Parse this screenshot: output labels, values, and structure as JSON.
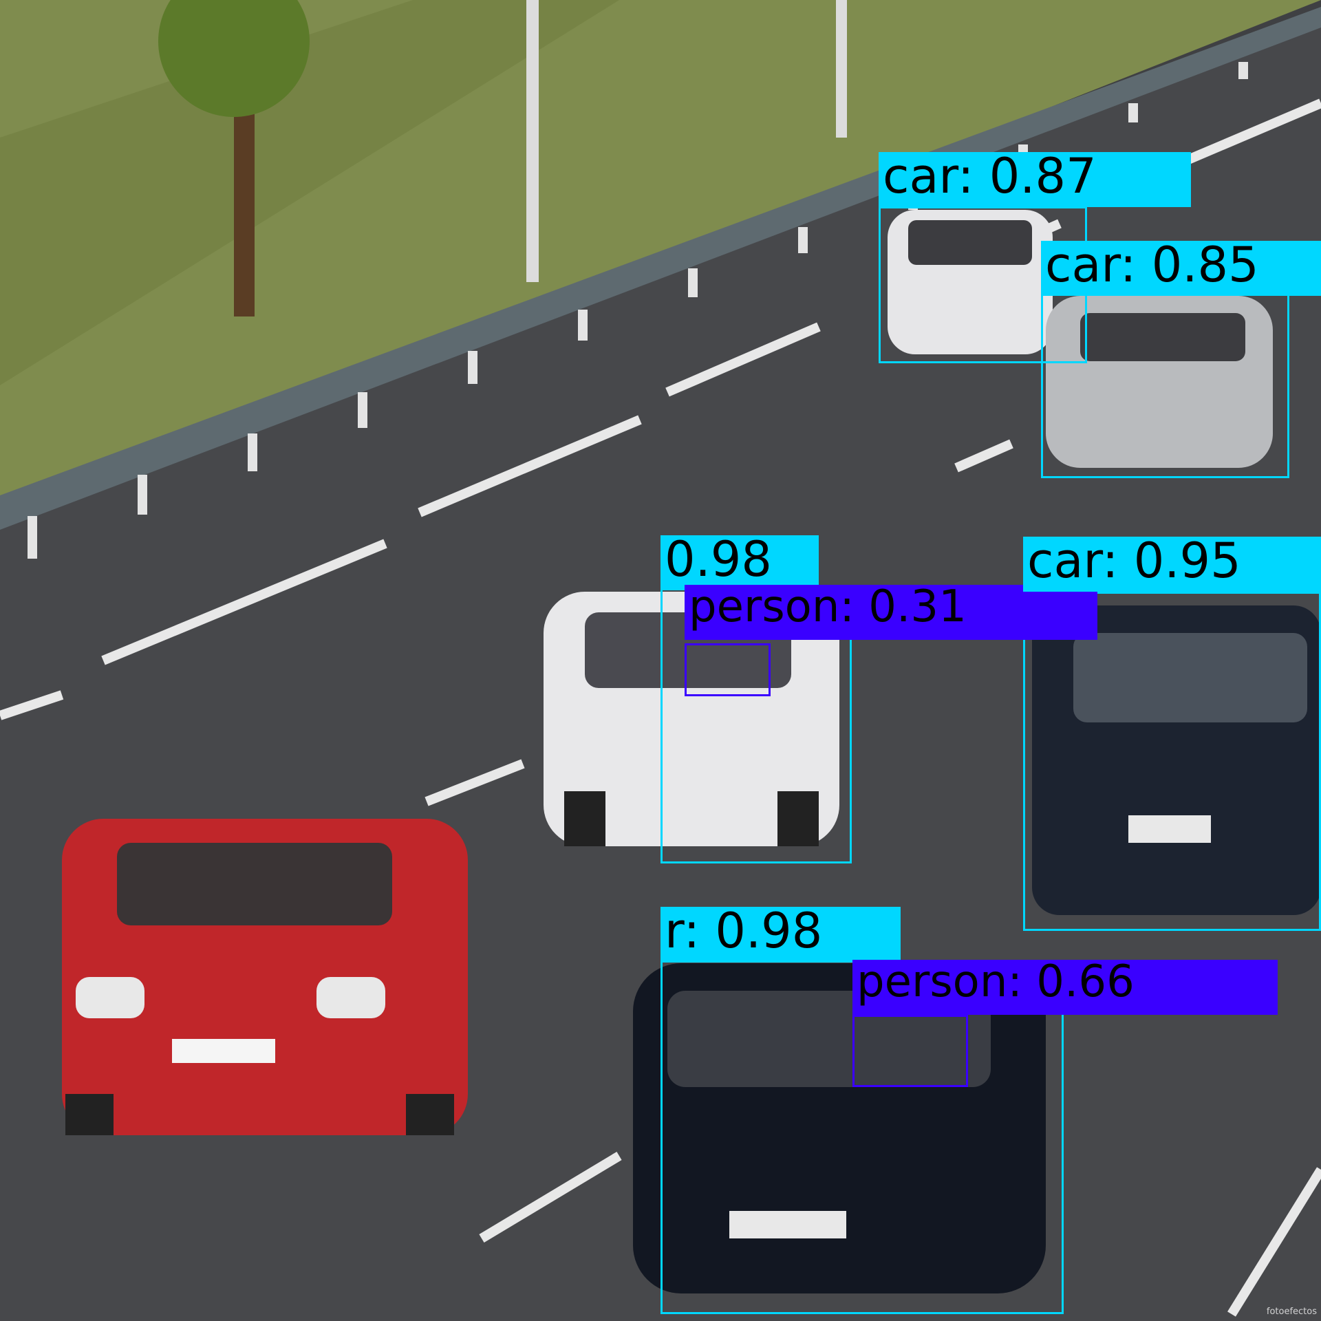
{
  "detections": [
    {
      "class": "car",
      "label_text": "car: 0.87",
      "confidence": 0.87
    },
    {
      "class": "car",
      "label_text": "car: 0.85",
      "confidence": 0.85
    },
    {
      "class": "car",
      "label_text": "0.98",
      "confidence": 0.98
    },
    {
      "class": "person",
      "label_text": "person: 0.31",
      "confidence": 0.31
    },
    {
      "class": "car",
      "label_text": "car: 0.95",
      "confidence": 0.95
    },
    {
      "class": "car",
      "label_text": "r: 0.98",
      "confidence": 0.98
    },
    {
      "class": "person",
      "label_text": "person: 0.66",
      "confidence": 0.66
    }
  ],
  "watermark": "fotoefectos",
  "colors": {
    "car_box": "#00d7ff",
    "person_box": "#3a00ff"
  }
}
